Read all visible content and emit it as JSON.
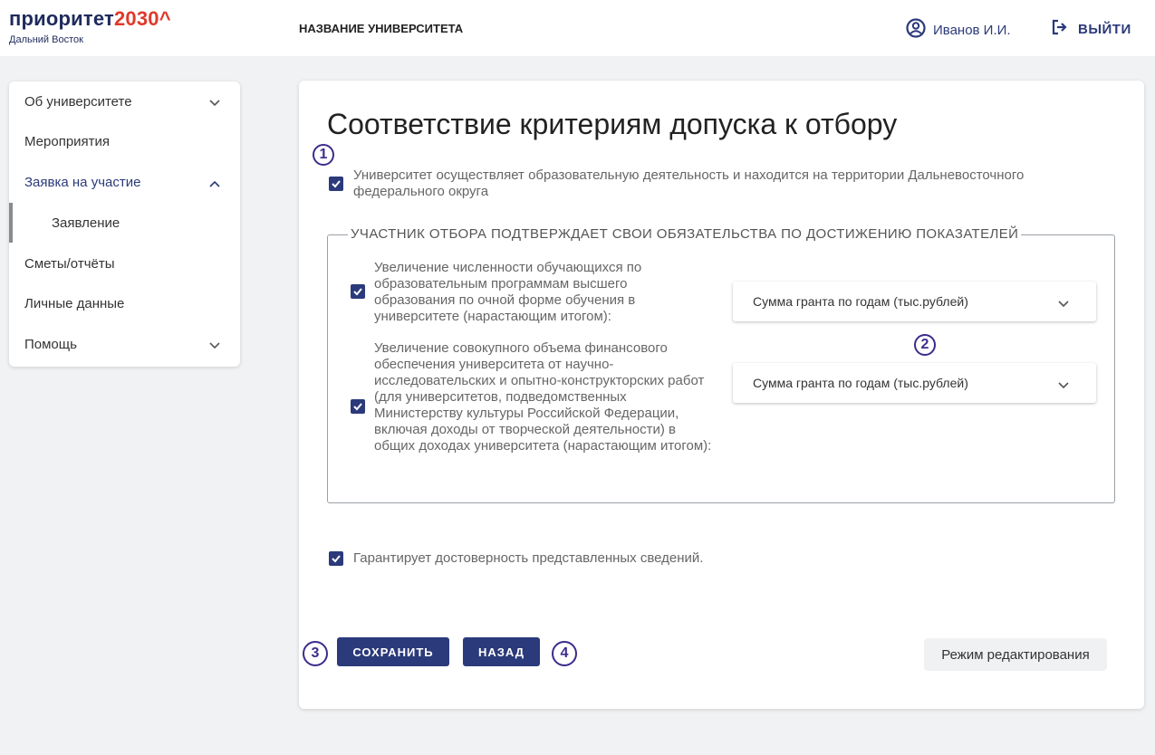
{
  "header": {
    "logo_main": "приоритет",
    "logo_num": "2030^",
    "logo_sub": "Дальний Восток",
    "university_name": "НАЗВАНИЕ УНИВЕРСИТЕТА",
    "user_name": "Иванов И.И.",
    "logout_label": "ВЫЙТИ"
  },
  "sidebar": {
    "items": [
      {
        "label": "Об университете"
      },
      {
        "label": "Мероприятия"
      },
      {
        "label": "Заявка на участие"
      },
      {
        "label": "Заявление"
      },
      {
        "label": "Сметы/отчёты"
      },
      {
        "label": "Личные данные"
      },
      {
        "label": "Помощь"
      }
    ]
  },
  "main": {
    "title": "Соответствие критериям допуска к отбору",
    "criterion_1": "Университет осуществляет образовательную деятельность и находится на территории Дальневосточного федерального округа",
    "fieldset_legend": "УЧАСТНИК ОТБОРА ПОДТВЕРЖДАЕТ СВОИ ОБЯЗАТЕЛЬСТВА ПО ДОСТИЖЕНИЮ ПОКАЗАТЕЛЕЙ",
    "indicator_1": "Увеличение численности обучающихся по образовательным программам высшего образования по очной форме обучения в университете (нарастающим итогом):",
    "indicator_2": "Увеличение совокупного объема финансового обеспечения университета от научно-исследовательских и опытно-конструкторских работ (для университетов, подведомственных Министерству культуры Российской Федерации, включая доходы от творческой деятельности) в общих доходах университета (нарастающим итогом):",
    "dropdown_1": "Сумма гранта по годам (тыс.рублей)",
    "dropdown_2": "Сумма гранта по годам (тыс.рублей)",
    "guarantee": "Гарантирует достоверность представленных сведений.",
    "save_label": "СОХРАНИТЬ",
    "back_label": "НАЗАД",
    "edit_mode_label": "Режим редактирования",
    "checkboxes_checked": true
  },
  "badges": {
    "b1": "1",
    "b2": "2",
    "b3": "3",
    "b4": "4"
  },
  "colors": {
    "accent": "#2b3a7a",
    "brand_red": "#e0392b",
    "badge": "#3a2d8c"
  }
}
